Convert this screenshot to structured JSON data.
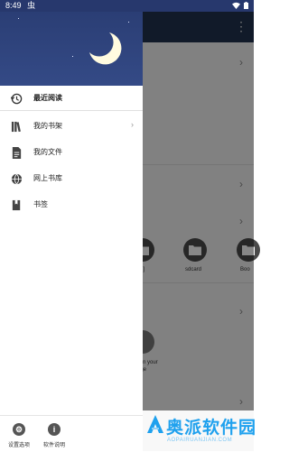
{
  "status_bar": {
    "time": "8:49",
    "bug_glyph": "虫"
  },
  "app_bar": {
    "more_glyph": "⋮"
  },
  "background_folders": [
    {
      "label": "ex]"
    },
    {
      "label": "sdcard"
    },
    {
      "label": "Boo"
    }
  ],
  "background_texts": {
    "line1": "s in your",
    "line2": "age"
  },
  "drawer": {
    "menu": [
      {
        "label": "最近阅读",
        "icon": "history-icon",
        "active": true
      },
      {
        "label": "我的书架",
        "icon": "bookshelf-icon",
        "has_arrow": true
      },
      {
        "label": "我的文件",
        "icon": "file-icon"
      },
      {
        "label": "网上书库",
        "icon": "globe-icon"
      },
      {
        "label": "书签",
        "icon": "bookmark-icon"
      }
    ],
    "arrow_glyph": "›",
    "footer": [
      {
        "label": "设置选项",
        "icon": "settings-icon",
        "glyph": "⚙"
      },
      {
        "label": "软件说明",
        "icon": "info-icon",
        "glyph": "i"
      }
    ]
  },
  "watermark": {
    "brand": "奥派软件园",
    "sub": "AOPAIRUANJIAN.COM"
  },
  "colors": {
    "header": "#293c72",
    "app_bar": "#21324f",
    "watermark": "#1fa1ee"
  }
}
